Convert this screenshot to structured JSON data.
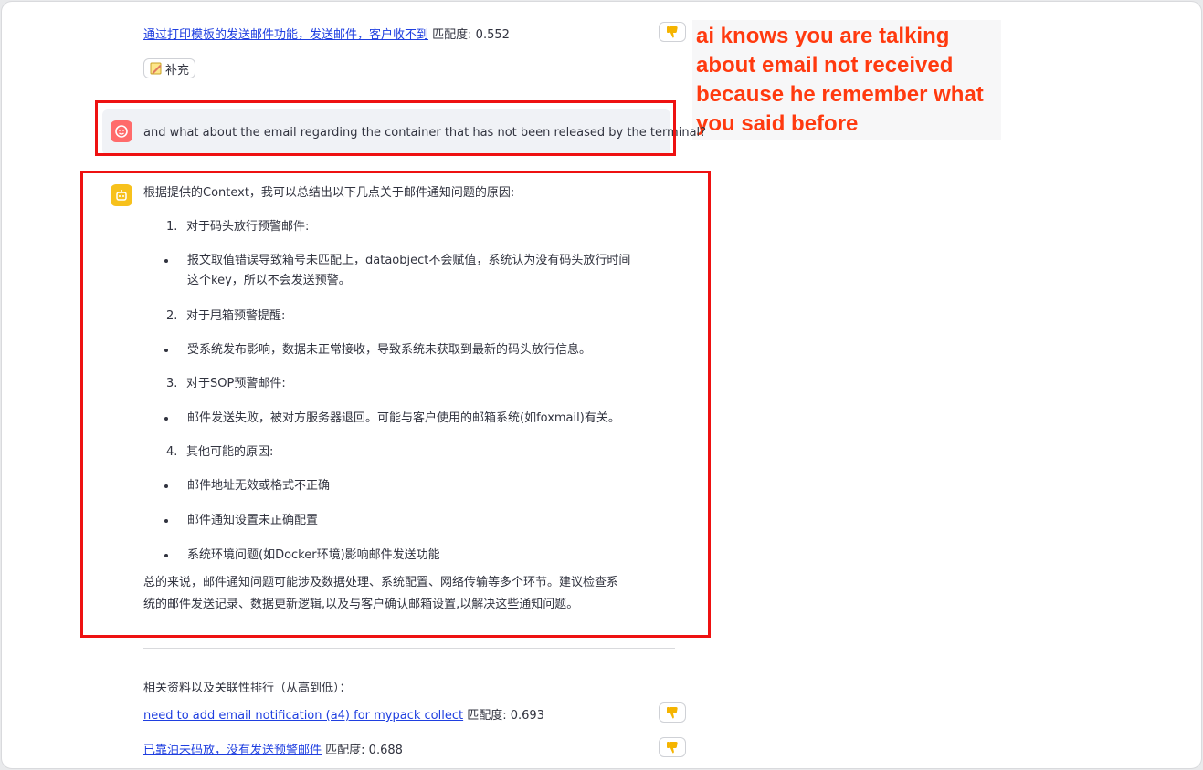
{
  "top_doc": {
    "title": "通过打印模板的发送邮件功能，发送邮件，客户收不到",
    "score_label": "匹配度: 0.552"
  },
  "supplement_button": {
    "label": "补充",
    "icon": "memo-icon"
  },
  "annotation": {
    "text": "ai knows you are talking about email not received because he remember what you said before",
    "color": "#ff3a0f"
  },
  "user_message": {
    "text": "and what about the email regarding the container that has not been released by the terminal?"
  },
  "assistant": {
    "intro": "根据提供的Context，我可以总结出以下几点关于邮件通知问题的原因:",
    "items": [
      {
        "marker": "1.",
        "text": "对于码头放行预警邮件:"
      },
      {
        "marker": "•",
        "text": "报文取值错误导致箱号未匹配上，dataobject不会赋值，系统认为没有码头放行时间"
      },
      {
        "marker": "",
        "text": "这个key，所以不会发送预警。"
      },
      {
        "marker": "2.",
        "text": "对于甩箱预警提醒:"
      },
      {
        "marker": "•",
        "text": "受系统发布影响，数据未正常接收，导致系统未获取到最新的码头放行信息。"
      },
      {
        "marker": "3.",
        "text": "对于SOP预警邮件:"
      },
      {
        "marker": "•",
        "text": "邮件发送失败，被对方服务器退回。可能与客户使用的邮箱系统(如foxmail)有关。"
      },
      {
        "marker": "4.",
        "text": "其他可能的原因:"
      },
      {
        "marker": "•",
        "text": "邮件地址无效或格式不正确"
      },
      {
        "marker": "•",
        "text": "邮件通知设置未正确配置"
      },
      {
        "marker": "•",
        "text": "系统环境问题(如Docker环境)影响邮件发送功能"
      }
    ],
    "summary_1": "总的来说，邮件通知问题可能涉及数据处理、系统配置、网络传输等多个环节。建议检查系",
    "summary_2": "统的邮件发送记录、数据更新逻辑,以及与客户确认邮箱设置,以解决这些通知问题。"
  },
  "related": {
    "heading": "相关资料以及关联性排行（从高到低）：",
    "docs": [
      {
        "title": "need to add email notification (a4) for mypack collect",
        "score_label": "匹配度: 0.693"
      },
      {
        "title": "已靠泊未码放，没有发送预警邮件",
        "score_label": "匹配度: 0.688"
      }
    ]
  },
  "colors": {
    "highlight_box": "#ee1111",
    "link": "#1f3fe0",
    "user_avatar": "#ff6b6b",
    "bot_avatar": "#f7c11c",
    "thumb": "#f5b400"
  }
}
